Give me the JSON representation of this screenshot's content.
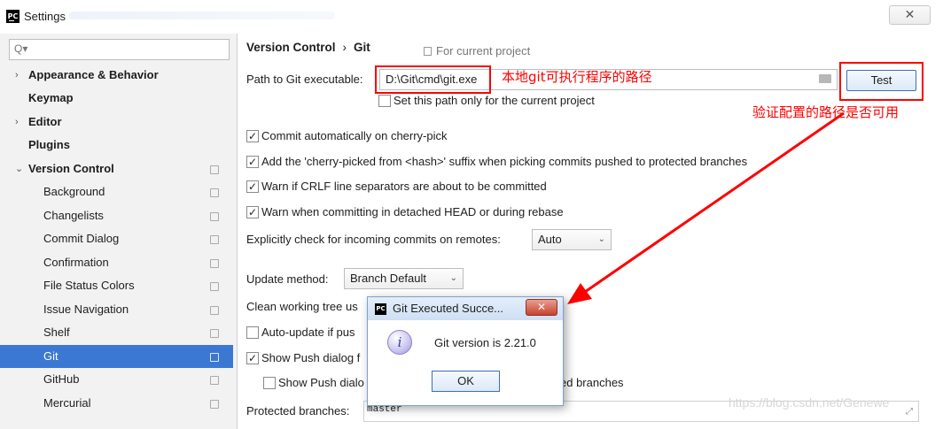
{
  "window": {
    "title": "Settings",
    "close_glyph": "✕"
  },
  "search": {
    "placeholder": "Q▾"
  },
  "sidebar": {
    "items": [
      {
        "label": "Appearance & Behavior"
      },
      {
        "label": "Keymap"
      },
      {
        "label": "Editor"
      },
      {
        "label": "Plugins"
      },
      {
        "label": "Version Control"
      },
      {
        "label": "Background"
      },
      {
        "label": "Changelists"
      },
      {
        "label": "Commit Dialog"
      },
      {
        "label": "Confirmation"
      },
      {
        "label": "File Status Colors"
      },
      {
        "label": "Issue Navigation"
      },
      {
        "label": "Shelf"
      },
      {
        "label": "Git"
      },
      {
        "label": "GitHub"
      },
      {
        "label": "Mercurial"
      }
    ]
  },
  "breadcrumb": {
    "parent": "Version Control",
    "sep": "›",
    "current": "Git",
    "for_project": "For current project"
  },
  "git_path": {
    "label": "Path to Git executable:",
    "value": "D:\\Git\\cmd\\git.exe",
    "test_button": "Test"
  },
  "annotations": {
    "path_note": "本地git可执行程序的路径",
    "test_note": "验证配置的路径是否可用",
    "color": "#ff0000"
  },
  "options": {
    "path_only_current": "Set this path only for the current project",
    "cherry_pick": "Commit automatically on cherry-pick",
    "cherry_suffix": "Add the 'cherry-picked from <hash>' suffix when picking commits pushed to protected branches",
    "crlf": "Warn if CRLF line separators are about to be committed",
    "detached": "Warn when committing in detached HEAD or during rebase",
    "incoming_label": "Explicitly check for incoming commits on remotes:",
    "incoming_value": "Auto",
    "update_label": "Update method:",
    "update_value": "Branch Default",
    "clean_tree": "Clean working tree us",
    "auto_update": "Auto-update if pus",
    "show_push": "Show Push dialog f",
    "show_push_only": "Show Push dialo",
    "show_push_only_tail": "ed branches",
    "protected_label": "Protected branches:",
    "protected_value": "master"
  },
  "dialog": {
    "title": "Git Executed Succe...",
    "close": "✕",
    "message": "Git version is 2.21.0",
    "ok": "OK",
    "icon": "i"
  },
  "watermark": "https://blog.csdn.net/Genewe"
}
